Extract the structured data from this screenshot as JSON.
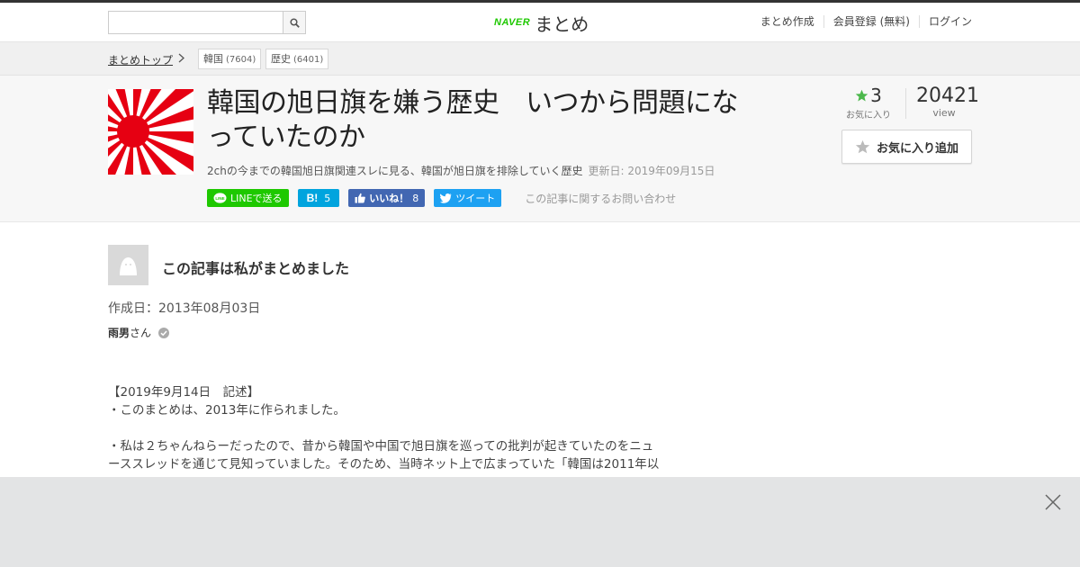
{
  "header": {
    "search_placeholder": "",
    "logo_naver": "NAVER",
    "logo_matome": "まとめ",
    "nav": [
      "まとめ作成",
      "会員登録 (無料)",
      "ログイン"
    ]
  },
  "breadcrumb": {
    "home": "まとめトップ",
    "tags": [
      {
        "label": "韓国",
        "count": "(7604)"
      },
      {
        "label": "歴史",
        "count": "(6401)"
      }
    ]
  },
  "article": {
    "title": "韓国の旭日旗を嫌う歴史　いつから問題になっていたのか",
    "description": "2chの今までの韓国旭日旗関連スレに見る、韓国が旭日旗を排除していく歴史",
    "updated": "更新日: 2019年09月15日",
    "favorites": "3",
    "favorites_label": "お気に入り",
    "views": "20421",
    "views_label": "view",
    "fav_button": "お気に入り追加"
  },
  "social": {
    "line": "LINEで送る",
    "hatena_count": "5",
    "fb_like": "いいね！",
    "fb_count": "8",
    "tweet": "ツイート",
    "inquiry": "この記事に関するお問い合わせ"
  },
  "author": {
    "heading": "この記事は私がまとめました",
    "created": "作成日：2013年08月03日",
    "name": "雨男",
    "suffix": "さん"
  },
  "body": {
    "line1": "【2019年9月14日　記述】",
    "line2": "・このまとめは、2013年に作られました。",
    "line3": "・私は２ちゃんねらーだったので、昔から韓国や中国で旭日旗を巡っての批判が起きていたのをニュ",
    "line4": "ーススレッドを通じて見知っていました。そのため、当時ネット上で広まっていた「韓国は2011年以"
  },
  "colors": {
    "line_green": "#1ec800",
    "hatena_blue": "#00a4de",
    "facebook_blue": "#4267b2",
    "twitter_blue": "#1da1f2",
    "star_green": "#4cb84c"
  }
}
